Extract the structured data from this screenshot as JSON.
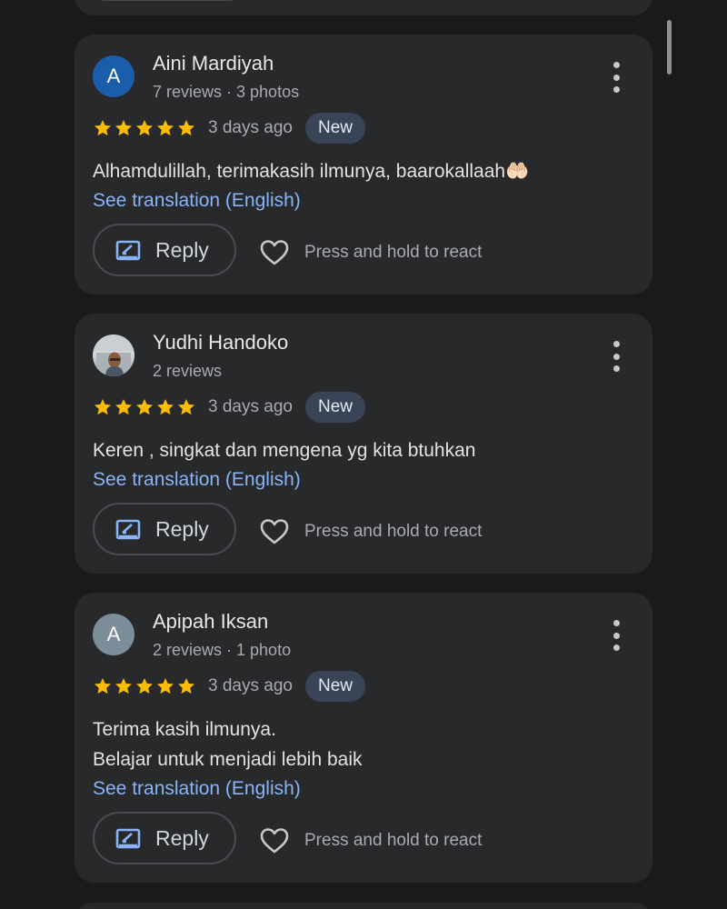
{
  "reviews": [
    {
      "avatar_letter": "A",
      "avatar_color": "#1a5dab",
      "avatar_type": "letter",
      "name": "Aini Mardiyah",
      "meta": "7 reviews · 3 photos",
      "rating": 5,
      "date": "3 days ago",
      "badge": "New",
      "text_lines": [
        "Alhamdulillah, terimakasih ilmunya, baarokallaah🤲🏻"
      ],
      "translation_link": "See translation (English)",
      "reply_label": "Reply",
      "react_label": "Press and hold to react"
    },
    {
      "avatar_letter": "",
      "avatar_color": "",
      "avatar_type": "photo",
      "name": "Yudhi Handoko",
      "meta": "2 reviews",
      "rating": 5,
      "date": "3 days ago",
      "badge": "New",
      "text_lines": [
        "Keren , singkat dan mengena yg kita btuhkan"
      ],
      "translation_link": "See translation (English)",
      "reply_label": "Reply",
      "react_label": "Press and hold to react"
    },
    {
      "avatar_letter": "A",
      "avatar_color": "#7b8e9a",
      "avatar_type": "letter",
      "name": "Apipah Iksan",
      "meta": "2 reviews · 1 photo",
      "rating": 5,
      "date": "3 days ago",
      "badge": "New",
      "text_lines": [
        "Terima kasih ilmunya.",
        "Belajar untuk menjadi lebih baik"
      ],
      "translation_link": "See translation (English)",
      "reply_label": "Reply",
      "react_label": "Press and hold to react"
    }
  ],
  "colors": {
    "background": "#1a1a1b",
    "card": "#28292b",
    "star": "#fbbc04",
    "link": "#8ab4f8",
    "badge_bg": "#394457",
    "reply_icon": "#8ab4f8"
  }
}
